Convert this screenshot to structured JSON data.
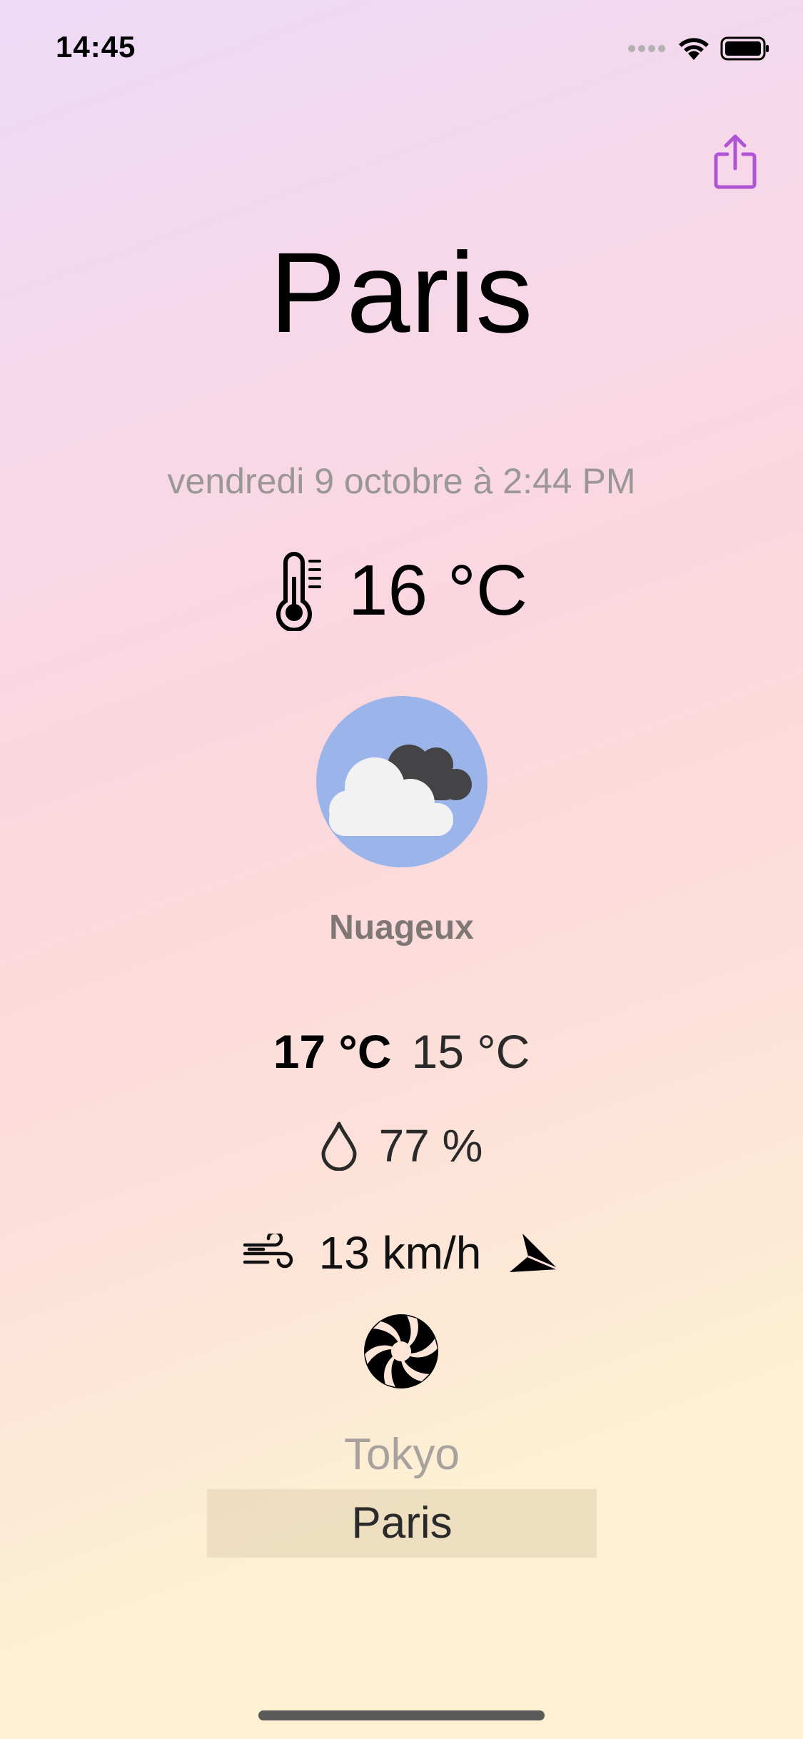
{
  "status_bar": {
    "time": "14:45",
    "icons": [
      "cellular-dots-icon",
      "wifi-icon",
      "battery-icon"
    ]
  },
  "share": {
    "icon": "share-icon",
    "color": "#b054d6"
  },
  "city": "Paris",
  "date": "vendredi 9 octobre à 2:44 PM",
  "temperature": {
    "icon": "thermometer-icon",
    "value": "16 °C"
  },
  "weather": {
    "icon": "cloudy-icon",
    "icon_bg": "#9bb5ea",
    "condition": "Nuageux"
  },
  "minmax": {
    "max": "17 °C",
    "min": "15 °C"
  },
  "humidity": {
    "icon": "drop-icon",
    "value": "77 %"
  },
  "wind": {
    "icon": "wind-icon",
    "speed": "13 km/h",
    "direction_icon": "paper-plane-icon"
  },
  "fan": {
    "icon": "fan-icon"
  },
  "picker": {
    "items": [
      "Tokyo",
      "Paris"
    ],
    "selected": "Paris"
  }
}
